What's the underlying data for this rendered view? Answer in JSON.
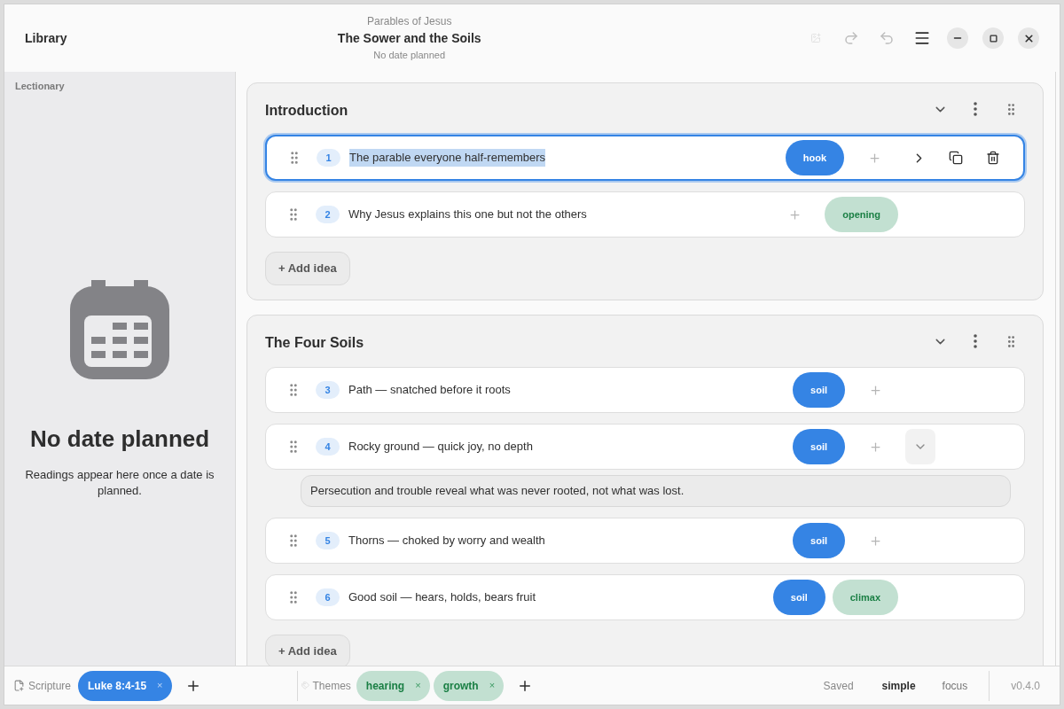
{
  "header": {
    "left_title": "Library",
    "subtitle": "Parables of Jesus",
    "title": "The Sower and the Soils",
    "status": "No date planned"
  },
  "sidebar": {
    "heading": "Lectionary",
    "empty_title": "No date planned",
    "empty_text": "Readings appear here once a date is planned."
  },
  "sections": [
    {
      "title": "Introduction",
      "add_label": "+ Add idea",
      "ideas": [
        {
          "number": "1",
          "text": "The parable everyone half-remembers",
          "selected": true,
          "expanded": false,
          "trailing": [
            {
              "kind": "tag",
              "label": "hook",
              "color": "#3584e4"
            },
            {
              "kind": "add"
            }
          ]
        },
        {
          "number": "2",
          "text": "Why Jesus explains this one but not the others",
          "selected": false,
          "expanded": false,
          "trailing": [
            {
              "kind": "add"
            },
            {
              "kind": "tag",
              "label": "opening",
              "color": "#c2e0d1"
            }
          ]
        }
      ]
    },
    {
      "title": "The Four Soils",
      "add_label": "+ Add idea",
      "ideas": [
        {
          "number": "3",
          "text": "Path — snatched before it roots",
          "selected": false,
          "expanded": false,
          "trailing": [
            {
              "kind": "tag",
              "label": "soil",
              "color": "#3584e4"
            },
            {
              "kind": "add"
            }
          ]
        },
        {
          "number": "4",
          "text": "Rocky ground — quick joy, no depth",
          "selected": false,
          "expanded": true,
          "note": "Persecution and trouble reveal what was never rooted, not what was lost.",
          "trailing": [
            {
              "kind": "tag",
              "label": "soil",
              "color": "#3584e4"
            },
            {
              "kind": "add"
            }
          ]
        },
        {
          "number": "5",
          "text": "Thorns — choked by worry and wealth",
          "selected": false,
          "expanded": false,
          "trailing": [
            {
              "kind": "tag",
              "label": "soil",
              "color": "#3584e4"
            },
            {
              "kind": "add"
            }
          ]
        },
        {
          "number": "6",
          "text": "Good soil — hears, holds, bears fruit",
          "selected": false,
          "expanded": false,
          "trailing": [
            {
              "kind": "tag",
              "label": "soil",
              "color": "#3584e4"
            },
            {
              "kind": "tag",
              "label": "climax",
              "color": "#c2e0d1"
            }
          ]
        }
      ]
    }
  ],
  "footer": {
    "scripture_label": "Scripture",
    "scripture": [
      {
        "label": "Luke 8:4-15",
        "remove": "×",
        "color": "#3584e4"
      }
    ],
    "themes_label": "Themes",
    "themes": [
      {
        "label": "hearing",
        "remove": "×",
        "color": "#c2e0d1"
      },
      {
        "label": "growth",
        "remove": "×",
        "color": "#c2e0d1"
      }
    ],
    "save_status": "Saved",
    "modes": [
      {
        "label": "simple",
        "selected": true
      },
      {
        "label": "focus",
        "selected": false
      }
    ],
    "version": "v0.4.0"
  }
}
